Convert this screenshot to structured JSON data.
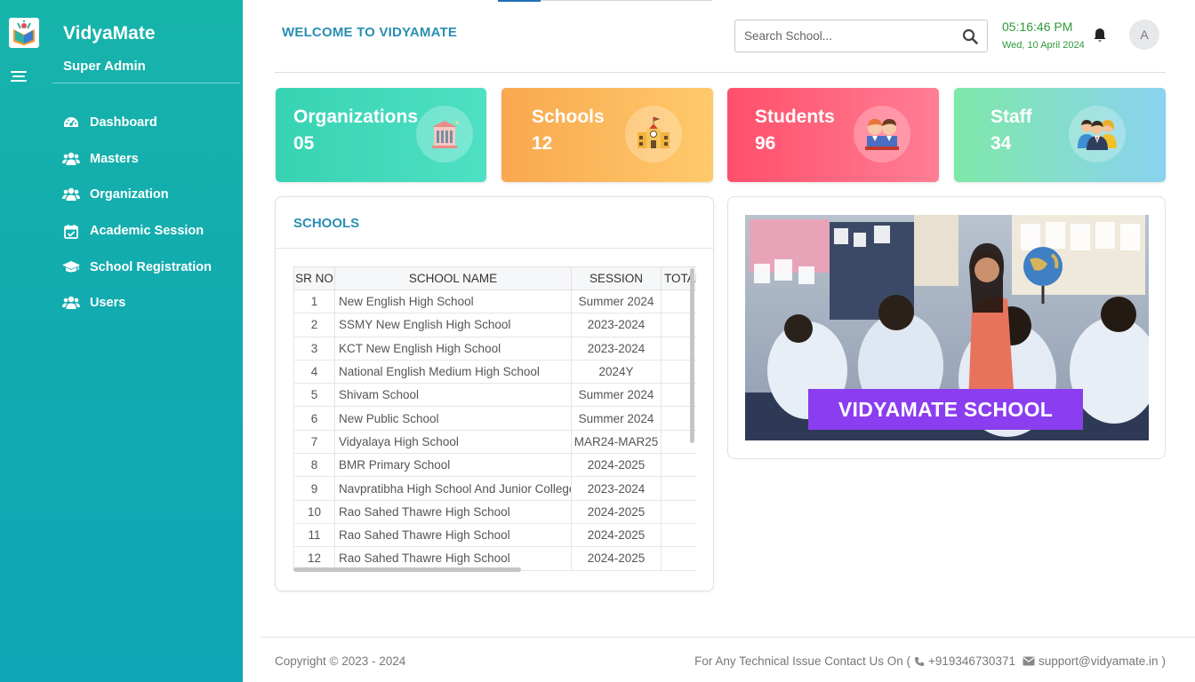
{
  "sidebar": {
    "brand": "VidyaMate",
    "role": "Super Admin",
    "items": [
      {
        "label": "Dashboard",
        "icon": "dashboard-icon"
      },
      {
        "label": "Masters",
        "icon": "users-icon"
      },
      {
        "label": "Organization",
        "icon": "users-icon"
      },
      {
        "label": "Academic Session",
        "icon": "calendar-check-icon"
      },
      {
        "label": "School Registration",
        "icon": "graduation-cap-icon"
      },
      {
        "label": "Users",
        "icon": "users-icon"
      }
    ],
    "gradient_from": "#17b4aa",
    "gradient_to": "#0fa5b5"
  },
  "header": {
    "welcome": "WELCOME TO VIDYAMATE",
    "search_placeholder": "Search School...",
    "time": "05:16:46 PM",
    "date": "Wed, 10 April 2024",
    "avatar_initial": "A"
  },
  "stats": [
    {
      "title": "Organizations",
      "value": "05",
      "color": "#37d3b3"
    },
    {
      "title": "Schools",
      "value": "12",
      "color": "#f9a84f"
    },
    {
      "title": "Students",
      "value": "96",
      "color": "#ff4f6b"
    },
    {
      "title": "Staff",
      "value": "34",
      "color": "#7ee8a8"
    }
  ],
  "schools": {
    "title": "SCHOOLS",
    "columns": [
      "SR NO",
      "SCHOOL NAME",
      "SESSION",
      "TOTAL"
    ],
    "rows": [
      {
        "no": "1",
        "name": "New English High School",
        "session": "Summer 2024"
      },
      {
        "no": "2",
        "name": "SSMY New English High School",
        "session": "2023-2024"
      },
      {
        "no": "3",
        "name": "KCT New English High School",
        "session": "2023-2024"
      },
      {
        "no": "4",
        "name": "National English Medium High School",
        "session": "2024Y"
      },
      {
        "no": "5",
        "name": "Shivam School",
        "session": "Summer 2024"
      },
      {
        "no": "6",
        "name": "New Public School",
        "session": "Summer 2024"
      },
      {
        "no": "7",
        "name": "Vidyalaya High School",
        "session": "MAR24-MAR25"
      },
      {
        "no": "8",
        "name": "BMR Primary School",
        "session": "2024-2025"
      },
      {
        "no": "9",
        "name": "Navpratibha High School And Junior College",
        "session": "2023-2024"
      },
      {
        "no": "10",
        "name": "Rao Sahed Thawre High School",
        "session": "2024-2025"
      },
      {
        "no": "11",
        "name": "Rao Sahed Thawre High School",
        "session": "2024-2025"
      },
      {
        "no": "12",
        "name": "Rao Sahed Thawre High School",
        "session": "2024-2025"
      }
    ]
  },
  "banner": {
    "text": "VIDYAMATE SCHOOL",
    "color": "#8b3df0"
  },
  "footer": {
    "copyright": "Copyright © 2023 - 2024",
    "contact_prefix": "For Any Technical Issue Contact Us On (",
    "phone": "+919346730371",
    "email": "support@vidyamate.in",
    "contact_suffix": ")"
  }
}
